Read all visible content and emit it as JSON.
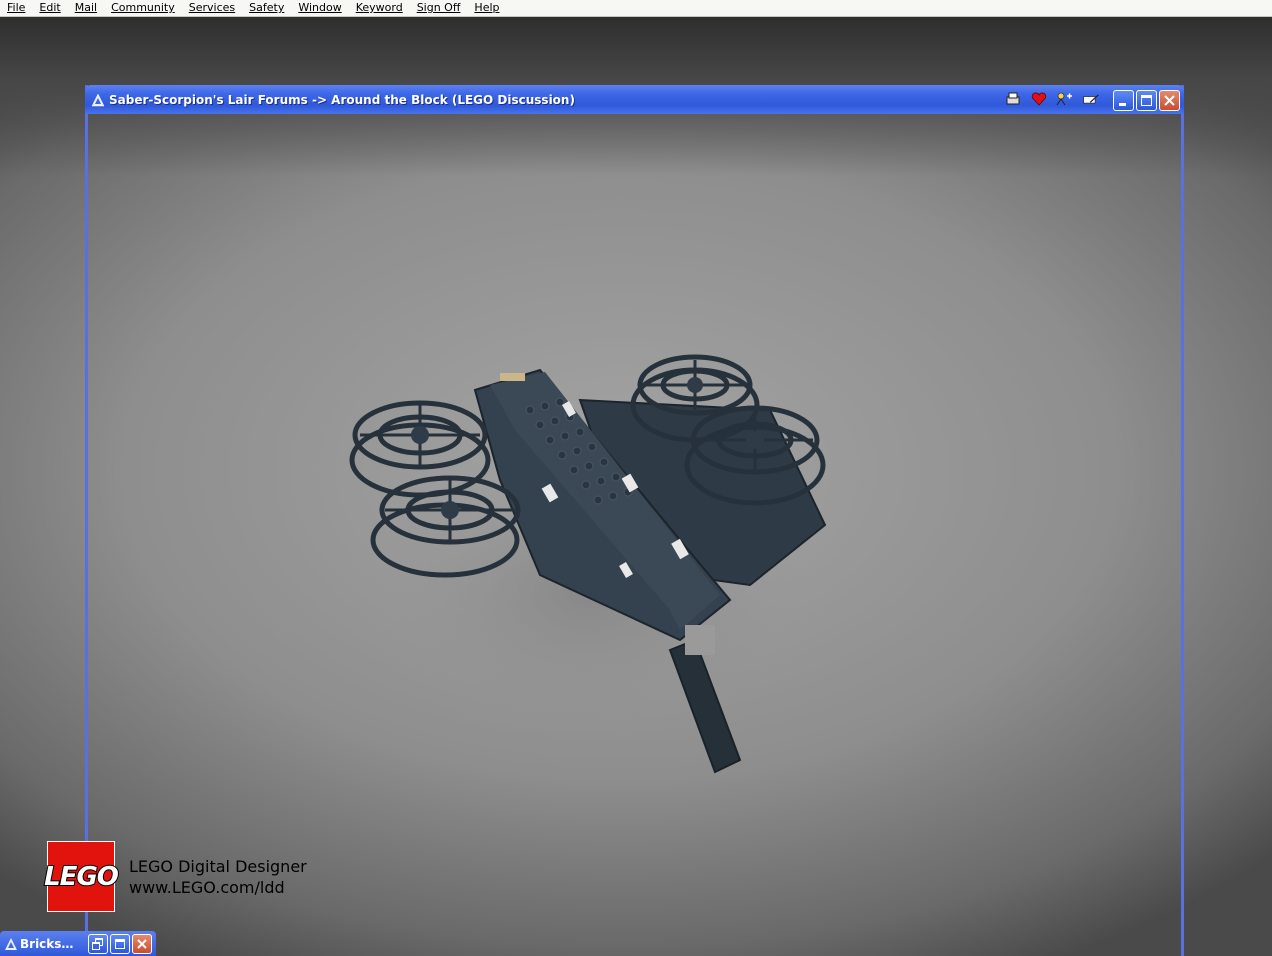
{
  "menubar": {
    "items": [
      "File",
      "Edit",
      "Mail",
      "Community",
      "Services",
      "Safety",
      "Window",
      "Keyword",
      "Sign Off",
      "Help"
    ]
  },
  "window": {
    "title": "Saber-Scorpion's Lair Forums -> Around the Block (LEGO Discussion)",
    "toolbar_icons": [
      "print-icon",
      "favorite-heart-icon",
      "people-icon",
      "edit-icon"
    ]
  },
  "viewer": {
    "logo_text": "LEGO",
    "product_name": "LEGO Digital Designer",
    "product_url": "www.LEGO.com/ldd"
  },
  "minimized_window": {
    "title": "Bricks…"
  },
  "colors": {
    "titlebar": "#2f59d9",
    "lego_red": "#e1140d",
    "model_body": "#2b3742"
  }
}
